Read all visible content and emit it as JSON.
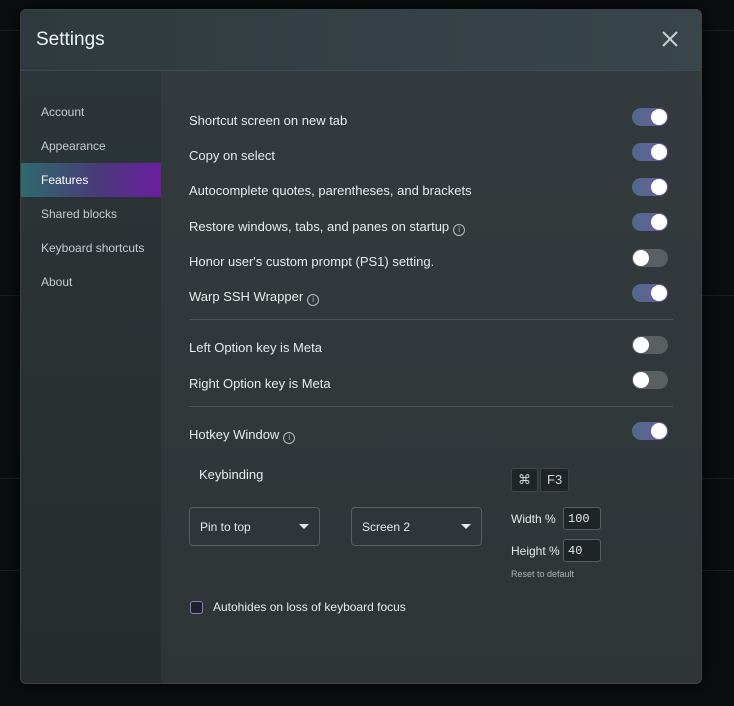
{
  "window": {
    "title": "Settings"
  },
  "sidebar": {
    "items": [
      {
        "label": "Account"
      },
      {
        "label": "Appearance"
      },
      {
        "label": "Features",
        "active": true
      },
      {
        "label": "Shared blocks"
      },
      {
        "label": "Keyboard shortcuts"
      },
      {
        "label": "About"
      }
    ]
  },
  "features": {
    "settings": [
      {
        "label": "Shortcut screen on new tab",
        "enabled": true,
        "info": false
      },
      {
        "label": "Copy on select",
        "enabled": true,
        "info": false
      },
      {
        "label": "Autocomplete quotes, parentheses, and brackets",
        "enabled": true,
        "info": false
      },
      {
        "label": "Restore windows, tabs, and panes on startup",
        "enabled": true,
        "info": true
      },
      {
        "label": "Honor user's custom prompt (PS1) setting.",
        "enabled": false,
        "info": false
      },
      {
        "label": "Warp SSH Wrapper",
        "enabled": true,
        "info": true
      },
      {
        "label": "Left Option key is Meta",
        "enabled": false,
        "info": false
      },
      {
        "label": "Right Option key is Meta",
        "enabled": false,
        "info": false
      },
      {
        "label": "Hotkey Window",
        "enabled": true,
        "info": true
      }
    ],
    "hotkey": {
      "keybinding_label": "Keybinding",
      "keys": [
        "⌘",
        "F3"
      ],
      "position_select": "Pin to top",
      "screen_select": "Screen 2",
      "width_label": "Width %",
      "width_value": "100",
      "height_label": "Height %",
      "height_value": "40",
      "reset_label": "Reset to default",
      "autohide_label": "Autohides on loss of keyboard focus",
      "autohide_checked": false
    }
  },
  "colors": {
    "accent_start": "#2e6b6c",
    "accent_end": "#6a1ea0",
    "toggle_on": "#5b63a0"
  },
  "icons": {
    "close": "close-icon",
    "info": "info-icon",
    "caret": "chevron-down-icon"
  }
}
